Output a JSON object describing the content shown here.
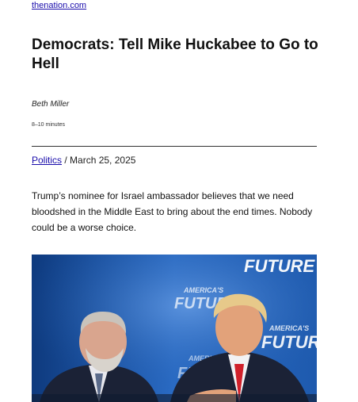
{
  "site": {
    "link": "thenation.com"
  },
  "article": {
    "title": "Democrats: Tell Mike Huckabee to Go to Hell",
    "author": "Beth Miller",
    "read_time": "8–10 minutes",
    "category": "Politics",
    "date_sep": " / ",
    "date": "March 25, 2025",
    "dek": "Trump’s nominee for Israel ambassador believes that we need bloodshed in the Middle East to bring about the end times. Nobody could be a worse choice."
  },
  "photo": {
    "backdrop_texts": [
      "FUTURE",
      "AMERICA'S",
      "FUTURE",
      "AMERICA'S",
      "FUTURE",
      "AMERICA'S",
      "FUTURE"
    ],
    "colors": {
      "backdrop": "#1f56a8",
      "tie": "#d0202a",
      "suit": "#1b2236"
    }
  }
}
